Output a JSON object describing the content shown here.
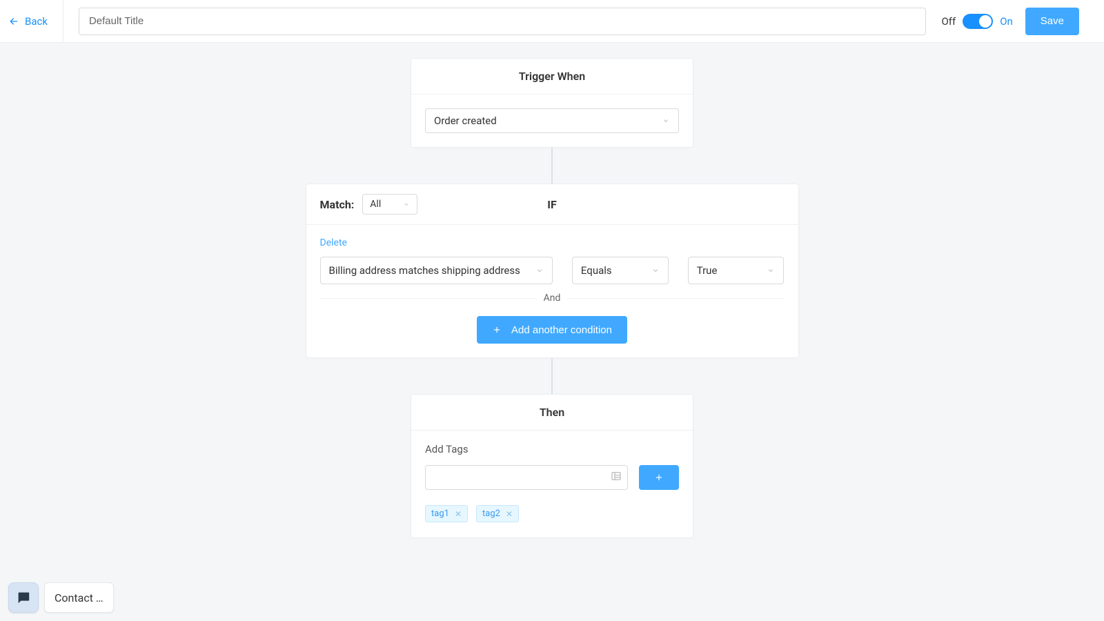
{
  "header": {
    "back_label": "Back",
    "title_value": "Default Title",
    "off_label": "Off",
    "on_label": "On",
    "save_label": "Save"
  },
  "trigger": {
    "title": "Trigger When",
    "selected": "Order created"
  },
  "if": {
    "match_label": "Match:",
    "match_value": "All",
    "if_label": "IF",
    "delete_label": "Delete",
    "condition": {
      "field": "Billing address matches shipping address",
      "operator": "Equals",
      "value": "True"
    },
    "divider_label": "And",
    "add_condition_label": "Add another condition"
  },
  "then": {
    "title": "Then",
    "section_label": "Add Tags",
    "tags": [
      "tag1",
      "tag2"
    ]
  },
  "chat": {
    "label": "Contact …"
  }
}
